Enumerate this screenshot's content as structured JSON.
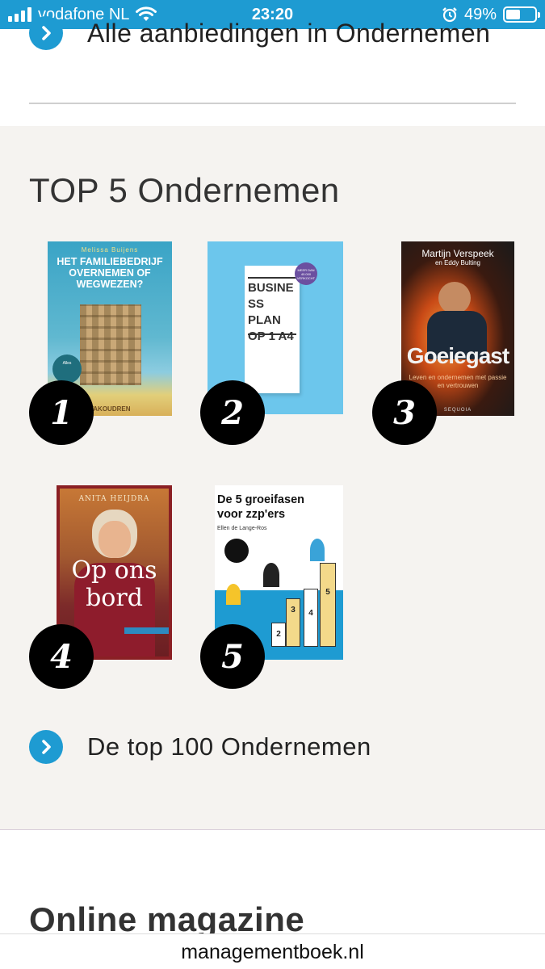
{
  "status": {
    "carrier": "vodafone NL",
    "time": "23:20",
    "battery": "49%",
    "battery_level": 0.49,
    "icons": [
      "signal-icon",
      "wifi-icon",
      "alarm-icon",
      "battery-icon"
    ]
  },
  "top_link": {
    "label": "Alle aanbiedingen in Ondernemen"
  },
  "top5": {
    "title": "TOP 5 Ondernemen",
    "books": [
      {
        "rank": "1",
        "author": "Melissa Buijens",
        "title": "HET FAMILIEBEDRIJF OVERNEMEN OF WEGWEZEN?",
        "publisher": "VAKOUDREN"
      },
      {
        "rank": "2",
        "title": "BUSINESS PLAN OP 1 A4",
        "badge": "MEER DAN 40.000 VERKOCHT"
      },
      {
        "rank": "3",
        "author": "Martijn Verspeek",
        "coauthor": "en Eddy Bulting",
        "title": "Goeiegast",
        "subtitle": "Leven en ondernemen met passie en vertrouwen",
        "publisher": "SEQUOIA"
      },
      {
        "rank": "4",
        "author": "ANITA HEIJDRA",
        "title_line1": "Op ons",
        "title_line2": "bord"
      },
      {
        "rank": "5",
        "title_line1": "De 5 groeifasen",
        "title_line2": "voor zzp'ers",
        "author": "Ellen de Lange-Ros"
      }
    ],
    "more_link": "De top 100 Ondernemen"
  },
  "magazine": {
    "title": "Online magazine"
  },
  "url_bar": {
    "domain": "managementboek.nl"
  },
  "colors": {
    "accent": "#1e9bd2",
    "section_bg": "#f5f3f0"
  }
}
